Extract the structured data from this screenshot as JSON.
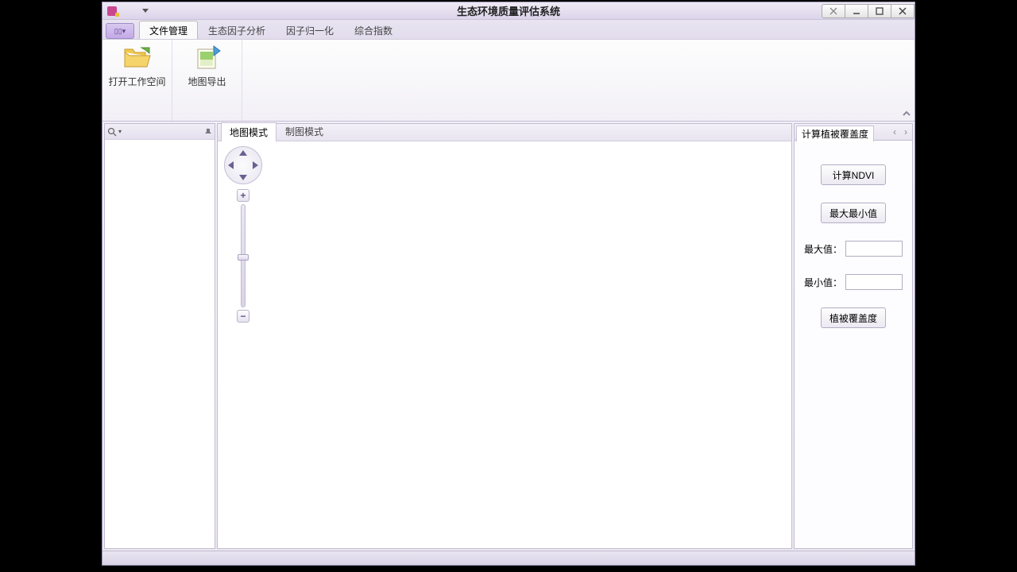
{
  "window": {
    "title": "生态环境质量评估系统"
  },
  "ribbon": {
    "tabs": [
      {
        "label": "文件管理"
      },
      {
        "label": "生态因子分析"
      },
      {
        "label": "因子归一化"
      },
      {
        "label": "综合指数"
      }
    ],
    "groups": [
      {
        "label": "打开工作空间"
      },
      {
        "label": "地图导出"
      }
    ]
  },
  "center": {
    "tabs": [
      {
        "label": "地图模式"
      },
      {
        "label": "制图模式"
      }
    ]
  },
  "right": {
    "title": "计算植被覆盖度",
    "buttons": {
      "ndvi": "计算NDVI",
      "minmax": "最大最小值",
      "coverage": "植被覆盖度"
    },
    "fields": {
      "max_label": "最大值：",
      "max_value": "",
      "min_label": "最小值：",
      "min_value": ""
    }
  }
}
